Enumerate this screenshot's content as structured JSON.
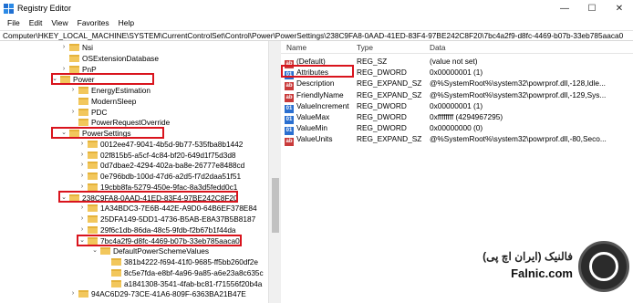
{
  "window": {
    "title": "Registry Editor",
    "controls": [
      "—",
      "☐",
      "✕"
    ]
  },
  "menu": [
    "File",
    "Edit",
    "View",
    "Favorites",
    "Help"
  ],
  "address": "Computer\\HKEY_LOCAL_MACHINE\\SYSTEM\\CurrentControlSet\\Control\\Power\\PowerSettings\\238C9FA8-0AAD-41ED-83F4-97BE242C8F20\\7bc4a2f9-d8fc-4469-b07b-33eb785aaca0",
  "tree": [
    {
      "label": "Nsi",
      "chev": ">"
    },
    {
      "label": "OSExtensionDatabase",
      "chev": ""
    },
    {
      "label": "PnP",
      "chev": ">"
    },
    {
      "label": "Power",
      "chev": "v"
    },
    {
      "label": "EnergyEstimation",
      "chev": ">"
    },
    {
      "label": "ModernSleep",
      "chev": ""
    },
    {
      "label": "PDC",
      "chev": ">"
    },
    {
      "label": "PowerRequestOverride",
      "chev": ""
    },
    {
      "label": "PowerSettings",
      "chev": "v"
    },
    {
      "label": "0012ee47-9041-4b5d-9b77-535fba8b1442",
      "chev": ">"
    },
    {
      "label": "02f815b5-a5cf-4c84-bf20-649d1f75d3d8",
      "chev": ">"
    },
    {
      "label": "0d7dbae2-4294-402a-ba8e-26777e8488cd",
      "chev": ">"
    },
    {
      "label": "0e796bdb-100d-47d6-a2d5-f7d2daa51f51",
      "chev": ">"
    },
    {
      "label": "19cbb8fa-5279-450e-9fac-8a3d5fedd0c1",
      "chev": ">"
    },
    {
      "label": "238C9FA8-0AAD-41ED-83F4-97BE242C8F20",
      "chev": "v"
    },
    {
      "label": "1A34BDC3-7E6B-442E-A9D0-64B6EF378E84",
      "chev": ">"
    },
    {
      "label": "25DFA149-5DD1-4736-B5AB-E8A37B5B8187",
      "chev": ">"
    },
    {
      "label": "29f6c1db-86da-48c5-9fdb-f2b67b1f44da",
      "chev": ">"
    },
    {
      "label": "7bc4a2f9-d8fc-4469-b07b-33eb785aaca0",
      "chev": "v"
    },
    {
      "label": "DefaultPowerSchemeValues",
      "chev": "v"
    },
    {
      "label": "381b4222-f694-41f0-9685-ff5bb260df2e",
      "chev": ""
    },
    {
      "label": "8c5e7fda-e8bf-4a96-9a85-a6e23a8c635c",
      "chev": ""
    },
    {
      "label": "a1841308-3541-4fab-bc81-f71556f20b4a",
      "chev": ""
    },
    {
      "label": "94AC6D29-73CE-41A6-809F-6363BA21B47E",
      "chev": ">"
    }
  ],
  "list": {
    "headers": {
      "name": "Name",
      "type": "Type",
      "data": "Data"
    },
    "rows": [
      {
        "icon": "ab",
        "name": "(Default)",
        "type": "REG_SZ",
        "data": "(value not set)"
      },
      {
        "icon": "bin",
        "name": "Attributes",
        "type": "REG_DWORD",
        "data": "0x00000001 (1)"
      },
      {
        "icon": "ab",
        "name": "Description",
        "type": "REG_EXPAND_SZ",
        "data": "@%SystemRoot%\\system32\\powrprof.dll,-128,Idle..."
      },
      {
        "icon": "ab",
        "name": "FriendlyName",
        "type": "REG_EXPAND_SZ",
        "data": "@%SystemRoot%\\system32\\powrprof.dll,-129,Sys..."
      },
      {
        "icon": "bin",
        "name": "ValueIncrement",
        "type": "REG_DWORD",
        "data": "0x00000001 (1)"
      },
      {
        "icon": "bin",
        "name": "ValueMax",
        "type": "REG_DWORD",
        "data": "0xffffffff (4294967295)"
      },
      {
        "icon": "bin",
        "name": "ValueMin",
        "type": "REG_DWORD",
        "data": "0x00000000 (0)"
      },
      {
        "icon": "ab",
        "name": "ValueUnits",
        "type": "REG_EXPAND_SZ",
        "data": "@%SystemRoot%\\system32\\powrprof.dll,-80,Seco..."
      }
    ]
  },
  "watermark": {
    "persian": "فالنیک (ایران اچ پی)",
    "site": "Falnic.com"
  },
  "colors": {
    "highlight": "#d9141d",
    "folder": "#f2c75c"
  }
}
